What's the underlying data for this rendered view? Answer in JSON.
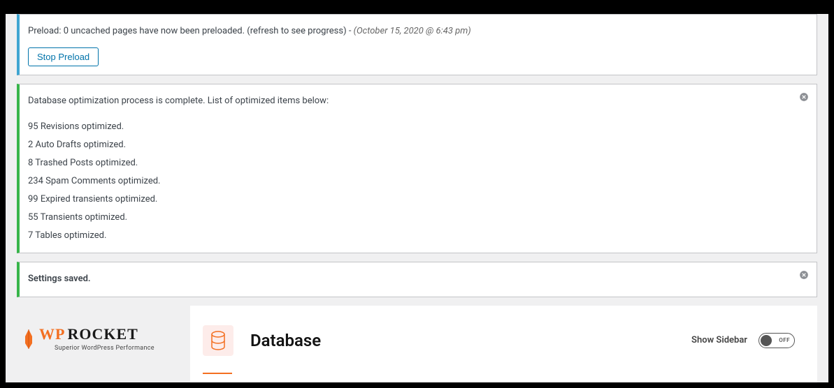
{
  "preload_notice": {
    "text": "Preload: 0 uncached pages have now been preloaded. (refresh to see progress) - ",
    "timestamp": "(October 15, 2020 @ 6:43 pm)",
    "stop_label": "Stop Preload"
  },
  "db_notice": {
    "title": "Database optimization process is complete. List of optimized items below:",
    "items": [
      "95 Revisions optimized.",
      "2 Auto Drafts optimized.",
      "8 Trashed Posts optimized.",
      "234 Spam Comments optimized.",
      "99 Expired transients optimized.",
      "55 Transients optimized.",
      "7 Tables optimized."
    ]
  },
  "saved_notice": {
    "text": "Settings saved."
  },
  "logo": {
    "wp": "WP",
    "rocket": "ROCKET",
    "tagline": "Superior WordPress Performance"
  },
  "header": {
    "title": "Database",
    "show_sidebar": "Show Sidebar",
    "toggle_state": "OFF"
  }
}
